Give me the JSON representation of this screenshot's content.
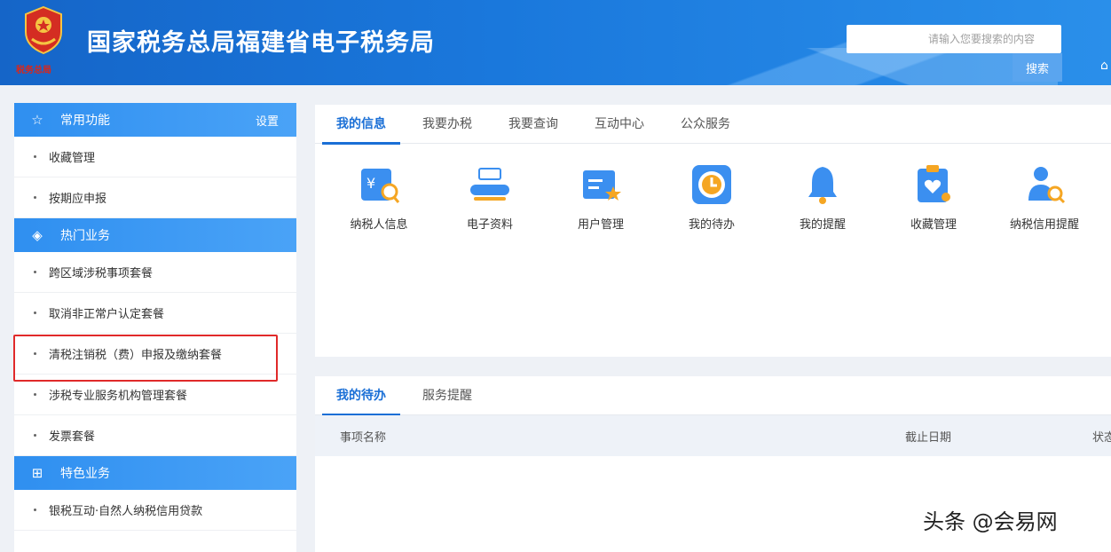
{
  "header": {
    "title": "国家税务总局福建省电子税务局",
    "emblem_seal": "税务总局",
    "search_placeholder": "请输入您要搜索的内容",
    "search_button": "搜索"
  },
  "sidebar": {
    "common": {
      "title": "常用功能",
      "settings": "设置",
      "items": [
        "收藏管理",
        "按期应申报"
      ]
    },
    "hot": {
      "title": "热门业务",
      "items": [
        "跨区域涉税事项套餐",
        "取消非正常户认定套餐",
        "清税注销税（费）申报及缴纳套餐",
        "涉税专业服务机构管理套餐",
        "发票套餐"
      ]
    },
    "featured": {
      "title": "特色业务",
      "items": [
        "银税互动·自然人纳税信用贷款"
      ]
    }
  },
  "info_panel": {
    "tabs": [
      "我的信息",
      "我要办税",
      "我要查询",
      "互动中心",
      "公众服务"
    ],
    "shortcuts": [
      {
        "label": "纳税人信息",
        "icon": "taxpayer-info-icon"
      },
      {
        "label": "电子资料",
        "icon": "electronic-data-icon"
      },
      {
        "label": "用户管理",
        "icon": "user-management-icon"
      },
      {
        "label": "我的待办",
        "icon": "todo-clock-icon"
      },
      {
        "label": "我的提醒",
        "icon": "bell-icon"
      },
      {
        "label": "收藏管理",
        "icon": "favorites-icon"
      },
      {
        "label": "纳税信用提醒",
        "icon": "credit-reminder-icon"
      }
    ]
  },
  "todo_panel": {
    "tabs": [
      "我的待办",
      "服务提醒"
    ],
    "columns": [
      "事项名称",
      "截止日期",
      "状态"
    ]
  },
  "watermark": "头条 @会易网",
  "colors": {
    "primary": "#1a6fd6",
    "header": "#1a78dc",
    "highlight": "#e02a2a"
  }
}
